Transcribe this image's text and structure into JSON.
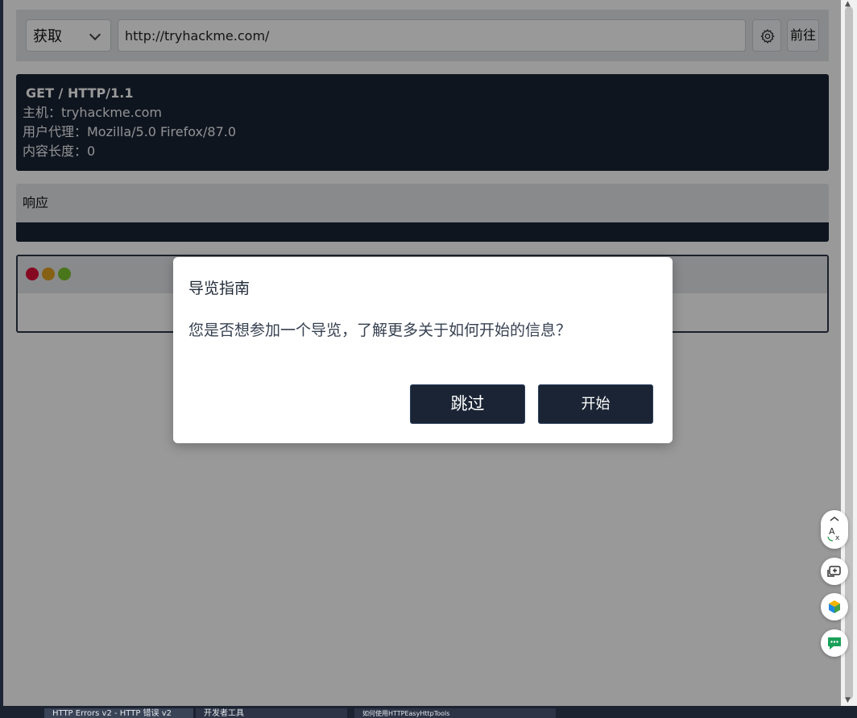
{
  "toolbar": {
    "method": "获取",
    "url": "http://tryhackme.com/",
    "go_label": "前往"
  },
  "request": {
    "request_line": "GET / HTTP/1.1",
    "headers": [
      "主机：tryhackme.com",
      "用户代理：Mozilla/5.0 Firefox/87.0",
      "内容长度：0"
    ]
  },
  "response": {
    "title": "响应"
  },
  "browser": {
    "dot_colors": [
      "#e0103a",
      "#e0a020",
      "#7ac52c"
    ]
  },
  "modal": {
    "title": "导览指南",
    "message": "您是否想参加一个导览，了解更多关于如何开始的信息？",
    "skip_label": "跳过",
    "start_label": "开始"
  },
  "taskbar": {
    "items": [
      "HTTP Errors v2 - HTTP 错误 v2",
      "开发者工具",
      "如何使用HTTPEasyHttpTools"
    ]
  },
  "colors": {
    "dark_panel": "#1a2434",
    "overlay": "rgba(0,0,0,0.4)"
  },
  "floating_icons": [
    "translate-icon",
    "screenshot-icon",
    "cube-icon",
    "chat-icon"
  ]
}
